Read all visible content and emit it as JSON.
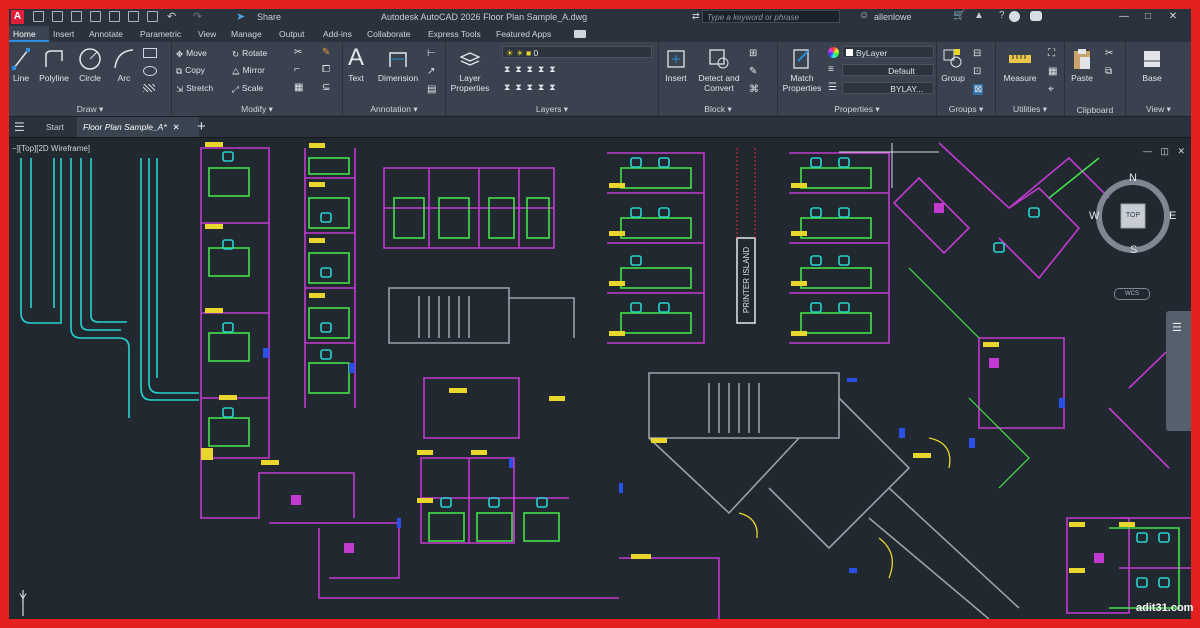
{
  "window": {
    "title": "Autodesk AutoCAD 2026   Floor Plan Sample_A.dwg",
    "app_icon": "A",
    "share_label": "Share",
    "search_placeholder": "Type a keyword or phrase",
    "user": "allenlowe"
  },
  "ribbon_tabs": [
    "Home",
    "Insert",
    "Annotate",
    "Parametric",
    "View",
    "Manage",
    "Output",
    "Add-ins",
    "Collaborate",
    "Express Tools",
    "Featured Apps"
  ],
  "panels": {
    "draw": {
      "label": "Draw",
      "buttons": [
        "Line",
        "Polyline",
        "Circle",
        "Arc"
      ]
    },
    "modify": {
      "label": "Modify",
      "buttons": [
        "Move",
        "Rotate",
        "Copy",
        "Mirror",
        "Stretch",
        "Scale"
      ]
    },
    "annotation": {
      "label": "Annotation",
      "buttons": [
        "Text",
        "Dimension"
      ]
    },
    "layers": {
      "label": "Layers",
      "layer_properties": "Layer Properties",
      "layer_value": "0"
    },
    "block": {
      "label": "Block",
      "buttons": [
        "Insert",
        "Detect and Convert"
      ]
    },
    "properties": {
      "label": "Properties",
      "match_properties": "Match Properties",
      "color": "ByLayer",
      "linetype": "Default",
      "lineweight": "BYLAY..."
    },
    "groups": {
      "label": "Groups",
      "button": "Group"
    },
    "utilities": {
      "label": "Utilities",
      "button": "Measure"
    },
    "clipboard": {
      "label": "Clipboard",
      "button": "Paste"
    },
    "view": {
      "label": "View",
      "button": "Base"
    }
  },
  "file_tabs": {
    "start": "Start",
    "active": "Floor Plan Sample_A*"
  },
  "viewport": {
    "label": "−][Top][2D Wireframe]",
    "viewcube": {
      "north": "N",
      "south": "S",
      "east": "E",
      "west": "W",
      "face": "TOP",
      "ucs": "WCS"
    },
    "printer_island": "PRINTER ISLAND",
    "ucs_axis": "Y"
  },
  "watermark": "adit31.com",
  "colors": {
    "canvas": "#212830",
    "magenta": "#c23ad0",
    "green": "#45e04a",
    "cyan": "#26d4d0",
    "yellow": "#e9d62c",
    "blue": "#2a50e8",
    "white": "#d8dde3",
    "gray": "#8a9098"
  }
}
